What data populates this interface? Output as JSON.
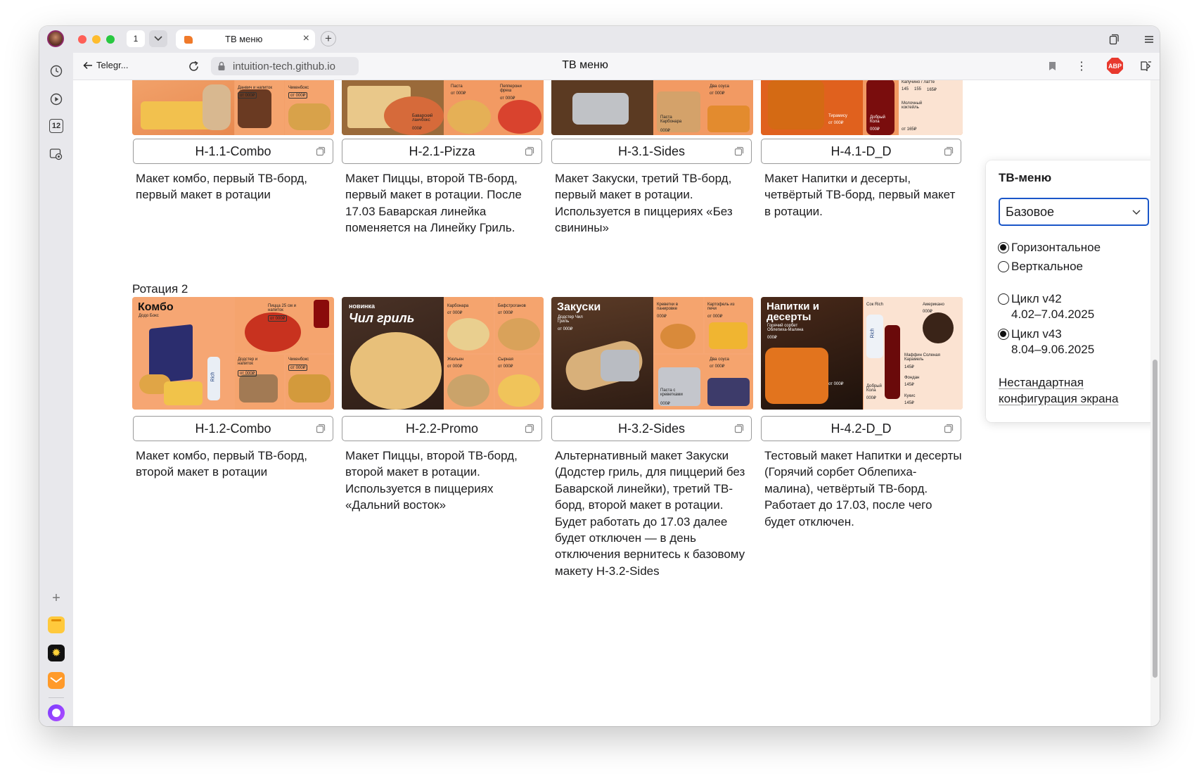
{
  "browser": {
    "tab_count": "1",
    "tab_title": "ТВ меню",
    "back_label": "Telegr...",
    "address": "intuition-tech.github.io",
    "page_title": "ТВ меню",
    "abp_label": "ABP"
  },
  "sidebar": {
    "badge_number": "12"
  },
  "colors": {
    "accent_blue": "#1a56c8",
    "card_orange": "#f29a63"
  },
  "rotation2_title": "Ротация 2",
  "rotation1": [
    {
      "code": "Н-1.1-Combo",
      "description": "Макет комбо, первый ТВ-борд, первый макет в ротации",
      "image_texts": [
        "Данвич и напиток",
        "от 000₽",
        "Чикенбокс",
        "от 000₽"
      ]
    },
    {
      "code": "Н-2.1-Pizza",
      "description": "Макет Пиццы, второй ТВ-борд, первый макет в ротации. После 17.03 Баварская линейка поменяется на Линейку Гриль.",
      "image_texts": [
        "Паста",
        "от 000₽",
        "Пепперони фреш",
        "от 000₽",
        "Баварский ланчбокс",
        "000₽"
      ]
    },
    {
      "code": "Н-3.1-Sides",
      "description": "Макет Закуски, третий ТВ-борд, первый макет в ротации. Используется в пиццериях «Без свинины»",
      "image_texts": [
        "Паста Карбонара",
        "000₽",
        "Два соуса",
        "от 000₽"
      ]
    },
    {
      "code": "Н-4.1-D_D",
      "description": "Макет Напитки и десерты, четвёртый ТВ-борд, первый макет в ротации.",
      "image_texts": [
        "Капучино / Латте",
        "145",
        "155",
        "165₽",
        "Молочный коктейль",
        "от 165₽",
        "Добрый Кола",
        "000₽",
        "Тирамису",
        "от 000₽"
      ]
    }
  ],
  "rotation2": [
    {
      "code": "Н-1.2-Combo",
      "description": "Макет комбо, первый ТВ-борд, второй макет в ротации",
      "image_texts": [
        "Комбо",
        "Додо Бокс",
        "Пицца 25 см и напиток",
        "от 000₽",
        "Додстер и напиток",
        "от 000₽",
        "Чикенбокс",
        "от 000₽",
        "Rich"
      ]
    },
    {
      "code": "Н-2.2-Promo",
      "description": "Макет Пиццы, второй ТВ-борд, второй макет в ротации. Используется в пиццериях «Дальний восток»",
      "image_texts": [
        "новинка",
        "Чил гриль",
        "Карбонара",
        "от 000₽",
        "Бефстроганов",
        "от 000₽",
        "Жюльен",
        "от 000₽",
        "Сырная",
        "от 000₽"
      ]
    },
    {
      "code": "Н-3.2-Sides",
      "description": "Альтернативный макет Закуски (Додстер гриль, для пиццерий без Баварской линейки), третий ТВ-борд, второй макет в ротации. Будет работать до 17.03 далее будет отключен — в день отключения вернитесь к базовому макету Н-3.2-Sides",
      "image_texts": [
        "Закуски",
        "Додстер Чил Гриль",
        "от 000₽",
        "Креветки в панировке",
        "000₽",
        "Картофель из печи",
        "от 000₽",
        "Два соуса",
        "от 000₽",
        "Паста с креветками",
        "000₽"
      ]
    },
    {
      "code": "Н-4.2-D_D",
      "description": "Тестовый макет Напитки и десерты (Горячий сорбет Облепиха-малина), четвёртый ТВ-борд. Работает до 17.03, после чего будет отключен.",
      "image_texts": [
        "Напитки и десерты",
        "Горячий сорбет Облепиха-Малина",
        "000₽",
        "Сок Rich",
        "Американо",
        "000₽",
        "Rich",
        "Маффин Соленая Карамель",
        "145₽",
        "Фондан",
        "145₽",
        "Добрый Кола",
        "000₽",
        "Кукис",
        "145₽",
        "Тирамису",
        "от 000₽"
      ]
    }
  ],
  "panel": {
    "title": "ТВ-меню",
    "select_value": "Базовое",
    "orientation_options": [
      {
        "label": "Горизонтальное",
        "checked": true
      },
      {
        "label": "Верткальное",
        "checked": false
      }
    ],
    "cycles": [
      {
        "label": "Цикл v42",
        "dates": "4.02–7.04.2025",
        "checked": false
      },
      {
        "label": "Цикл v43",
        "dates": "8.04–9.06.2025",
        "checked": true
      }
    ],
    "custom_link": "Нестандартная конфигурация экрана"
  }
}
